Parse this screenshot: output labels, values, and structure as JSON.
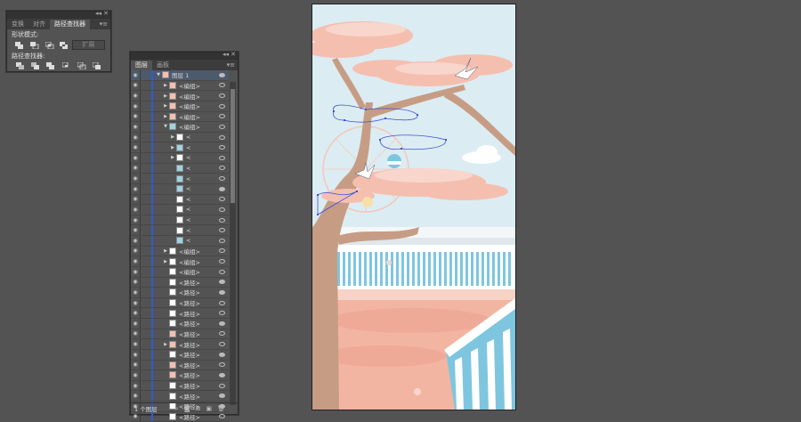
{
  "pathfinder_panel": {
    "tabs": [
      "变换",
      "对齐",
      "路径查找器"
    ],
    "active_tab": 2,
    "shape_modes_label": "形状模式:",
    "pathfinders_label": "路径查找器:",
    "expand_label": "扩展",
    "shape_mode_icons": [
      "unite-icon",
      "minus-front-icon",
      "intersect-icon",
      "exclude-icon"
    ],
    "pathfinder_icons": [
      "divide-icon",
      "trim-icon",
      "merge-icon",
      "crop-icon",
      "outline-icon",
      "minus-back-icon"
    ]
  },
  "layers_panel": {
    "tabs": [
      "图层",
      "画板"
    ],
    "active_tab": 0,
    "footer_text": "1 个图层",
    "rows": [
      {
        "name": "图层 1",
        "indent": 0,
        "arrow": "▼",
        "thumb": "peach",
        "selected": true,
        "target": "filled"
      },
      {
        "name": "<编组>",
        "indent": 1,
        "arrow": "▶",
        "thumb": "peach",
        "target": "open"
      },
      {
        "name": "<编组>",
        "indent": 1,
        "arrow": "▶",
        "thumb": "peach",
        "target": "open"
      },
      {
        "name": "<编组>",
        "indent": 1,
        "arrow": "▶",
        "thumb": "peach",
        "target": "open"
      },
      {
        "name": "<编组>",
        "indent": 1,
        "arrow": "▶",
        "thumb": "peach",
        "target": "open"
      },
      {
        "name": "<编组>",
        "indent": 1,
        "arrow": "▼",
        "thumb": "blue",
        "target": "open"
      },
      {
        "name": "<",
        "indent": 2,
        "arrow": "▶",
        "thumb": "white",
        "target": "open"
      },
      {
        "name": "<",
        "indent": 2,
        "arrow": "▶",
        "thumb": "blue",
        "target": "open"
      },
      {
        "name": "<",
        "indent": 2,
        "arrow": "▶",
        "thumb": "white",
        "target": "open"
      },
      {
        "name": "<",
        "indent": 2,
        "arrow": "",
        "thumb": "blue",
        "target": "open"
      },
      {
        "name": "<",
        "indent": 2,
        "arrow": "",
        "thumb": "blue",
        "target": "open"
      },
      {
        "name": "<",
        "indent": 2,
        "arrow": "",
        "thumb": "blue",
        "target": "filled"
      },
      {
        "name": "<",
        "indent": 2,
        "arrow": "",
        "thumb": "white",
        "target": "open"
      },
      {
        "name": "<",
        "indent": 2,
        "arrow": "",
        "thumb": "white",
        "target": "open"
      },
      {
        "name": "<",
        "indent": 2,
        "arrow": "",
        "thumb": "white",
        "target": "open"
      },
      {
        "name": "<",
        "indent": 2,
        "arrow": "",
        "thumb": "white",
        "target": "open"
      },
      {
        "name": "<",
        "indent": 2,
        "arrow": "",
        "thumb": "blue",
        "target": "open"
      },
      {
        "name": "<编组>",
        "indent": 1,
        "arrow": "▶",
        "thumb": "white",
        "target": "open"
      },
      {
        "name": "<编组>",
        "indent": 1,
        "arrow": "▶",
        "thumb": "white",
        "target": "open"
      },
      {
        "name": "<编组>",
        "indent": 1,
        "arrow": "",
        "thumb": "white",
        "target": "open"
      },
      {
        "name": "<路径>",
        "indent": 1,
        "arrow": "",
        "thumb": "white",
        "target": "filled"
      },
      {
        "name": "<路径>",
        "indent": 1,
        "arrow": "",
        "thumb": "white",
        "target": "filled"
      },
      {
        "name": "<路径>",
        "indent": 1,
        "arrow": "",
        "thumb": "white",
        "target": "open"
      },
      {
        "name": "<路径>",
        "indent": 1,
        "arrow": "",
        "thumb": "white",
        "target": "open"
      },
      {
        "name": "<路径>",
        "indent": 1,
        "arrow": "",
        "thumb": "white",
        "target": "filled"
      },
      {
        "name": "<路径>",
        "indent": 1,
        "arrow": "",
        "thumb": "peach",
        "target": "open"
      },
      {
        "name": "<路径>",
        "indent": 1,
        "arrow": "▶",
        "thumb": "peach",
        "target": "open"
      },
      {
        "name": "<路径>",
        "indent": 1,
        "arrow": "",
        "thumb": "white",
        "target": "filled"
      },
      {
        "name": "<路径>",
        "indent": 1,
        "arrow": "",
        "thumb": "peach",
        "target": "open"
      },
      {
        "name": "<路径>",
        "indent": 1,
        "arrow": "",
        "thumb": "peach",
        "target": "filled"
      },
      {
        "name": "<路径>",
        "indent": 1,
        "arrow": "",
        "thumb": "white",
        "target": "open"
      },
      {
        "name": "<路径>",
        "indent": 1,
        "arrow": "",
        "thumb": "white",
        "target": "filled"
      },
      {
        "name": "<路径>",
        "indent": 1,
        "arrow": "",
        "thumb": "white",
        "target": "filled"
      },
      {
        "name": "<路径>",
        "indent": 1,
        "arrow": "",
        "thumb": "white",
        "target": "open"
      }
    ]
  },
  "colors": {
    "workspace": "#535353",
    "sky": "#dcecf3",
    "cloud_pink": "#f5bfb0",
    "trunk": "#c79e85",
    "fence_blue": "#7ec6df",
    "ground_pink": "#f3b3a0",
    "selection_blue": "#3c52d8"
  }
}
